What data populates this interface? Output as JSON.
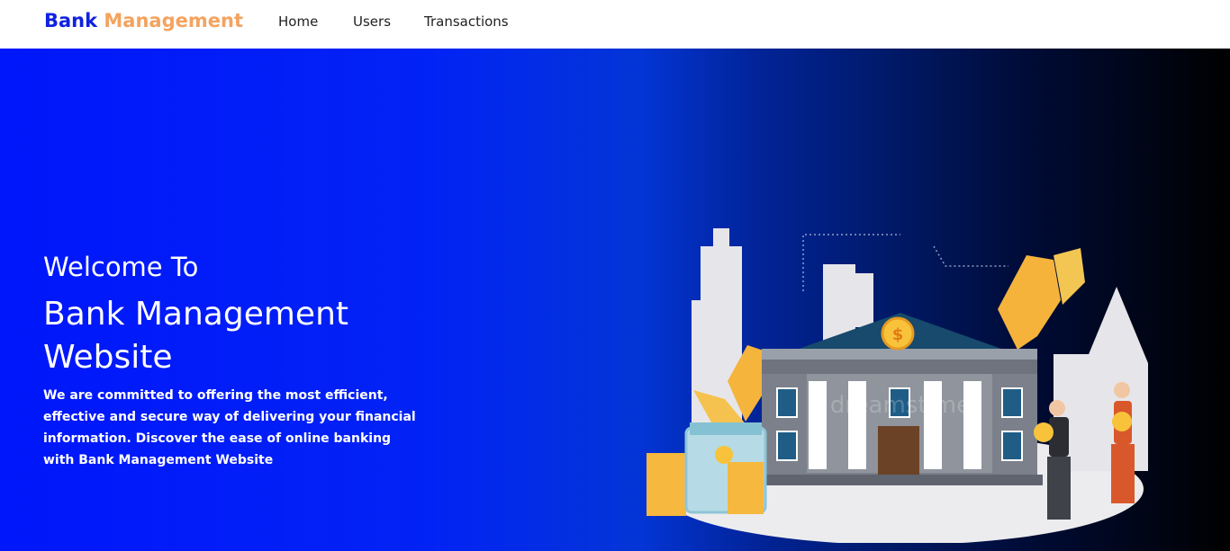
{
  "nav": {
    "brand_part1": "Bank",
    "brand_part2": "Management",
    "links": [
      "Home",
      "Users",
      "Transactions"
    ]
  },
  "hero": {
    "welcome": "Welcome To",
    "title_line1": "Bank Management",
    "title_line2": "Website",
    "description": "We are committed to offering the most efficient, effective and secure way of delivering your financial information. Discover the ease of online banking with Bank Management Website",
    "watermark": "dreamstime"
  },
  "colors": {
    "brand_blue": "#1022e0",
    "brand_orange": "#f4a35f",
    "hero_blue": "#0016fb",
    "hero_black": "#000000"
  }
}
